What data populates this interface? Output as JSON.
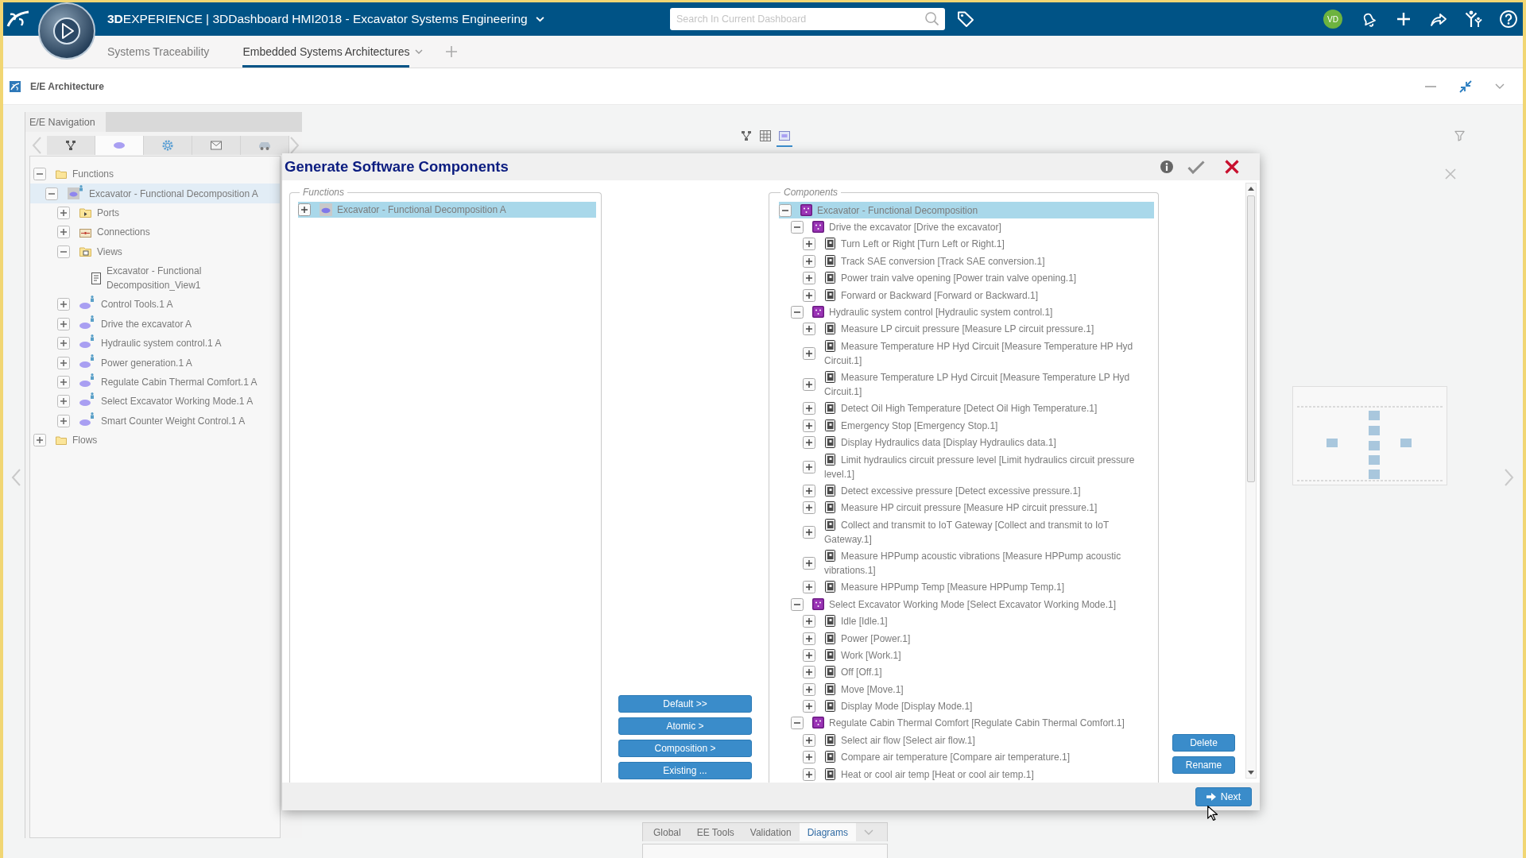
{
  "top_bar": {
    "title": "**3D**EXPERIENCE | 3DDashboard HMI2018 - Excavator Systems Engineering",
    "search": {
      "placeholder": "Search In Current Dashboard"
    },
    "avatar": "VD"
  },
  "dashboard_tabs": [
    {
      "label": "Systems Traceability",
      "selected": false
    },
    {
      "label": "Embedded Systems Architectures",
      "selected": true
    }
  ],
  "widget": {
    "title": "E/E Architecture"
  },
  "navigation": {
    "title": "E/E Navigation",
    "tabs": [
      {
        "kind": "network",
        "selected": false
      },
      {
        "kind": "function",
        "selected": true
      },
      {
        "kind": "gear",
        "selected": false
      },
      {
        "kind": "mail",
        "selected": false
      },
      {
        "kind": "car",
        "selected": false
      }
    ],
    "tree": [
      {
        "label": "Functions",
        "kind": "folder",
        "expanded": true,
        "selected": false,
        "children": [
          {
            "label": "Excavator - Functional Decomposition A",
            "kind": "decomposition",
            "expanded": true,
            "selected": true,
            "children": [
              {
                "label": "Ports",
                "kind": "ports",
                "expanded": false,
                "selected": false
              },
              {
                "label": "Connections",
                "kind": "connections",
                "expanded": false,
                "selected": false
              },
              {
                "label": "Views",
                "kind": "views",
                "expanded": true,
                "selected": false,
                "children": [
                  {
                    "label": "Excavator - Functional Decomposition_View1",
                    "kind": "view",
                    "selected": false
                  }
                ]
              },
              {
                "label": "Control Tools.1 A",
                "kind": "function",
                "expanded": false,
                "selected": false
              },
              {
                "label": "Drive the excavator A",
                "kind": "function",
                "expanded": false,
                "selected": false
              },
              {
                "label": "Hydraulic system control.1 A",
                "kind": "function",
                "expanded": false,
                "selected": false
              },
              {
                "label": "Power generation.1 A",
                "kind": "function",
                "expanded": false,
                "selected": false
              },
              {
                "label": "Regulate Cabin Thermal Comfort.1 A",
                "kind": "function",
                "expanded": false,
                "selected": false
              },
              {
                "label": "Select Excavator Working Mode.1 A",
                "kind": "function",
                "expanded": false,
                "selected": false
              },
              {
                "label": "Smart Counter Weight Control.1 A",
                "kind": "function",
                "expanded": false,
                "selected": false
              }
            ]
          }
        ]
      },
      {
        "label": "Flows",
        "kind": "folder",
        "expanded": false,
        "selected": false
      }
    ]
  },
  "canvas": {
    "view_modes": [
      {
        "kind": "hierarchy",
        "selected": false
      },
      {
        "kind": "grid",
        "selected": false
      },
      {
        "kind": "diagram",
        "selected": true
      }
    ],
    "bottom_tabs": [
      {
        "label": "Global",
        "selected": false
      },
      {
        "label": "EE Tools",
        "selected": false
      },
      {
        "label": "Validation",
        "selected": false
      },
      {
        "label": "Diagrams",
        "selected": true
      }
    ]
  },
  "dialog": {
    "title": "Generate Software Components",
    "functions": {
      "legend": "Functions",
      "items": [
        {
          "label": "Excavator - Functional Decomposition A",
          "kind": "block",
          "expanded": false,
          "selected": true
        }
      ]
    },
    "actions": [
      "Default >>",
      "Atomic >",
      "Composition >",
      "Existing ..."
    ],
    "components": {
      "legend": "Components",
      "items": [
        {
          "label": "Excavator - Functional Decomposition",
          "kind": "composition",
          "expanded": true,
          "selected": true,
          "children": [
            {
              "label": "Drive the excavator [Drive the excavator]",
              "kind": "composition",
              "expanded": true,
              "selected": false,
              "children": [
                {
                  "label": "Turn Left or Right [Turn Left or Right.1]",
                  "kind": "atomic",
                  "expanded": false,
                  "selected": false
                },
                {
                  "label": "Track SAE conversion [Track SAE conversion.1]",
                  "kind": "atomic",
                  "expanded": false,
                  "selected": false
                },
                {
                  "label": "Power train valve opening [Power train valve opening.1]",
                  "kind": "atomic",
                  "expanded": false,
                  "selected": false
                },
                {
                  "label": "Forward or Backward [Forward or Backward.1]",
                  "kind": "atomic",
                  "expanded": false,
                  "selected": false
                }
              ]
            },
            {
              "label": "Hydraulic system control [Hydraulic system control.1]",
              "kind": "composition",
              "expanded": true,
              "selected": false,
              "children": [
                {
                  "label": "Measure LP circuit pressure [Measure LP circuit pressure.1]",
                  "kind": "atomic",
                  "expanded": false,
                  "selected": false
                },
                {
                  "label": "Measure Temperature HP Hyd Circuit [Measure Temperature HP Hyd Circuit.1]",
                  "kind": "atomic",
                  "expanded": false,
                  "selected": false
                },
                {
                  "label": "Measure Temperature LP Hyd Circuit [Measure Temperature LP Hyd Circuit.1]",
                  "kind": "atomic",
                  "expanded": false,
                  "selected": false
                },
                {
                  "label": "Detect Oil High Temperature [Detect Oil High Temperature.1]",
                  "kind": "atomic",
                  "expanded": false,
                  "selected": false
                },
                {
                  "label": "Emergency Stop [Emergency Stop.1]",
                  "kind": "atomic",
                  "expanded": false,
                  "selected": false
                },
                {
                  "label": "Display Hydraulics data [Display Hydraulics data.1]",
                  "kind": "atomic",
                  "expanded": false,
                  "selected": false
                },
                {
                  "label": "Limit hydraulics circuit pressure level [Limit hydraulics circuit pressure level.1]",
                  "kind": "atomic",
                  "expanded": false,
                  "selected": false
                },
                {
                  "label": "Detect excessive pressure [Detect excessive pressure.1]",
                  "kind": "atomic",
                  "expanded": false,
                  "selected": false
                },
                {
                  "label": "Measure HP circuit pressure [Measure HP circuit pressure.1]",
                  "kind": "atomic",
                  "expanded": false,
                  "selected": false
                },
                {
                  "label": "Collect and transmit to IoT Gateway [Collect and transmit to IoT Gateway.1]",
                  "kind": "atomic",
                  "expanded": false,
                  "selected": false
                },
                {
                  "label": "Measure HPPump acoustic vibrations [Measure HPPump acoustic vibrations.1]",
                  "kind": "atomic",
                  "expanded": false,
                  "selected": false
                },
                {
                  "label": "Measure HPPump Temp [Measure HPPump Temp.1]",
                  "kind": "atomic",
                  "expanded": false,
                  "selected": false
                }
              ]
            },
            {
              "label": "Select Excavator Working Mode [Select Excavator Working Mode.1]",
              "kind": "composition",
              "expanded": true,
              "selected": false,
              "children": [
                {
                  "label": "Idle [Idle.1]",
                  "kind": "atomic",
                  "expanded": false,
                  "selected": false
                },
                {
                  "label": "Power [Power.1]",
                  "kind": "atomic",
                  "expanded": false,
                  "selected": false
                },
                {
                  "label": "Work [Work.1]",
                  "kind": "atomic",
                  "expanded": false,
                  "selected": false
                },
                {
                  "label": "Off [Off.1]",
                  "kind": "atomic",
                  "expanded": false,
                  "selected": false
                },
                {
                  "label": "Move [Move.1]",
                  "kind": "atomic",
                  "expanded": false,
                  "selected": false
                },
                {
                  "label": "Display Mode [Display Mode.1]",
                  "kind": "atomic",
                  "expanded": false,
                  "selected": false
                }
              ]
            },
            {
              "label": "Regulate Cabin Thermal Comfort [Regulate Cabin Thermal Comfort.1]",
              "kind": "composition",
              "expanded": true,
              "selected": false,
              "children": [
                {
                  "label": "Select air flow [Select air flow.1]",
                  "kind": "atomic",
                  "expanded": false,
                  "selected": false
                },
                {
                  "label": "Compare air temperature [Compare air temperature.1]",
                  "kind": "atomic",
                  "expanded": false,
                  "selected": false
                },
                {
                  "label": "Heat or cool air temp [Heat or cool air temp.1]",
                  "kind": "atomic",
                  "expanded": false,
                  "selected": false
                }
              ]
            }
          ]
        }
      ]
    },
    "side_actions": [
      "Delete",
      "Rename"
    ],
    "next": "Next"
  }
}
